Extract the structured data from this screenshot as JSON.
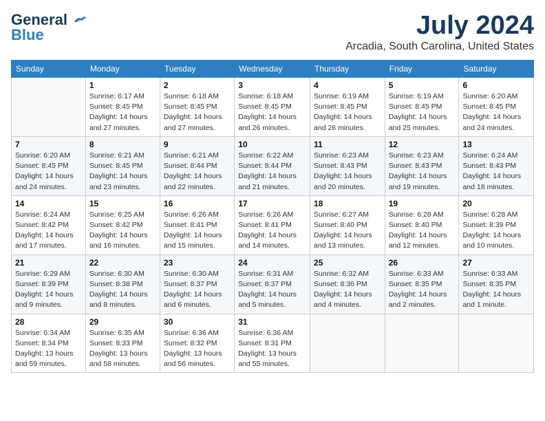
{
  "logo": {
    "line1": "General",
    "line2": "Blue"
  },
  "header": {
    "month": "July 2024",
    "location": "Arcadia, South Carolina, United States"
  },
  "weekdays": [
    "Sunday",
    "Monday",
    "Tuesday",
    "Wednesday",
    "Thursday",
    "Friday",
    "Saturday"
  ],
  "weeks": [
    [
      {
        "day": "",
        "sunrise": "",
        "sunset": "",
        "daylight": ""
      },
      {
        "day": "1",
        "sunrise": "Sunrise: 6:17 AM",
        "sunset": "Sunset: 8:45 PM",
        "daylight": "Daylight: 14 hours and 27 minutes."
      },
      {
        "day": "2",
        "sunrise": "Sunrise: 6:18 AM",
        "sunset": "Sunset: 8:45 PM",
        "daylight": "Daylight: 14 hours and 27 minutes."
      },
      {
        "day": "3",
        "sunrise": "Sunrise: 6:18 AM",
        "sunset": "Sunset: 8:45 PM",
        "daylight": "Daylight: 14 hours and 26 minutes."
      },
      {
        "day": "4",
        "sunrise": "Sunrise: 6:19 AM",
        "sunset": "Sunset: 8:45 PM",
        "daylight": "Daylight: 14 hours and 26 minutes."
      },
      {
        "day": "5",
        "sunrise": "Sunrise: 6:19 AM",
        "sunset": "Sunset: 8:45 PM",
        "daylight": "Daylight: 14 hours and 25 minutes."
      },
      {
        "day": "6",
        "sunrise": "Sunrise: 6:20 AM",
        "sunset": "Sunset: 8:45 PM",
        "daylight": "Daylight: 14 hours and 24 minutes."
      }
    ],
    [
      {
        "day": "7",
        "sunrise": "Sunrise: 6:20 AM",
        "sunset": "Sunset: 8:45 PM",
        "daylight": "Daylight: 14 hours and 24 minutes."
      },
      {
        "day": "8",
        "sunrise": "Sunrise: 6:21 AM",
        "sunset": "Sunset: 8:45 PM",
        "daylight": "Daylight: 14 hours and 23 minutes."
      },
      {
        "day": "9",
        "sunrise": "Sunrise: 6:21 AM",
        "sunset": "Sunset: 8:44 PM",
        "daylight": "Daylight: 14 hours and 22 minutes."
      },
      {
        "day": "10",
        "sunrise": "Sunrise: 6:22 AM",
        "sunset": "Sunset: 8:44 PM",
        "daylight": "Daylight: 14 hours and 21 minutes."
      },
      {
        "day": "11",
        "sunrise": "Sunrise: 6:23 AM",
        "sunset": "Sunset: 8:43 PM",
        "daylight": "Daylight: 14 hours and 20 minutes."
      },
      {
        "day": "12",
        "sunrise": "Sunrise: 6:23 AM",
        "sunset": "Sunset: 8:43 PM",
        "daylight": "Daylight: 14 hours and 19 minutes."
      },
      {
        "day": "13",
        "sunrise": "Sunrise: 6:24 AM",
        "sunset": "Sunset: 8:43 PM",
        "daylight": "Daylight: 14 hours and 18 minutes."
      }
    ],
    [
      {
        "day": "14",
        "sunrise": "Sunrise: 6:24 AM",
        "sunset": "Sunset: 8:42 PM",
        "daylight": "Daylight: 14 hours and 17 minutes."
      },
      {
        "day": "15",
        "sunrise": "Sunrise: 6:25 AM",
        "sunset": "Sunset: 8:42 PM",
        "daylight": "Daylight: 14 hours and 16 minutes."
      },
      {
        "day": "16",
        "sunrise": "Sunrise: 6:26 AM",
        "sunset": "Sunset: 8:41 PM",
        "daylight": "Daylight: 14 hours and 15 minutes."
      },
      {
        "day": "17",
        "sunrise": "Sunrise: 6:26 AM",
        "sunset": "Sunset: 8:41 PM",
        "daylight": "Daylight: 14 hours and 14 minutes."
      },
      {
        "day": "18",
        "sunrise": "Sunrise: 6:27 AM",
        "sunset": "Sunset: 8:40 PM",
        "daylight": "Daylight: 14 hours and 13 minutes."
      },
      {
        "day": "19",
        "sunrise": "Sunrise: 6:28 AM",
        "sunset": "Sunset: 8:40 PM",
        "daylight": "Daylight: 14 hours and 12 minutes."
      },
      {
        "day": "20",
        "sunrise": "Sunrise: 6:28 AM",
        "sunset": "Sunset: 8:39 PM",
        "daylight": "Daylight: 14 hours and 10 minutes."
      }
    ],
    [
      {
        "day": "21",
        "sunrise": "Sunrise: 6:29 AM",
        "sunset": "Sunset: 8:39 PM",
        "daylight": "Daylight: 14 hours and 9 minutes."
      },
      {
        "day": "22",
        "sunrise": "Sunrise: 6:30 AM",
        "sunset": "Sunset: 8:38 PM",
        "daylight": "Daylight: 14 hours and 8 minutes."
      },
      {
        "day": "23",
        "sunrise": "Sunrise: 6:30 AM",
        "sunset": "Sunset: 8:37 PM",
        "daylight": "Daylight: 14 hours and 6 minutes."
      },
      {
        "day": "24",
        "sunrise": "Sunrise: 6:31 AM",
        "sunset": "Sunset: 8:37 PM",
        "daylight": "Daylight: 14 hours and 5 minutes."
      },
      {
        "day": "25",
        "sunrise": "Sunrise: 6:32 AM",
        "sunset": "Sunset: 8:36 PM",
        "daylight": "Daylight: 14 hours and 4 minutes."
      },
      {
        "day": "26",
        "sunrise": "Sunrise: 6:33 AM",
        "sunset": "Sunset: 8:35 PM",
        "daylight": "Daylight: 14 hours and 2 minutes."
      },
      {
        "day": "27",
        "sunrise": "Sunrise: 6:33 AM",
        "sunset": "Sunset: 8:35 PM",
        "daylight": "Daylight: 14 hours and 1 minute."
      }
    ],
    [
      {
        "day": "28",
        "sunrise": "Sunrise: 6:34 AM",
        "sunset": "Sunset: 8:34 PM",
        "daylight": "Daylight: 13 hours and 59 minutes."
      },
      {
        "day": "29",
        "sunrise": "Sunrise: 6:35 AM",
        "sunset": "Sunset: 8:33 PM",
        "daylight": "Daylight: 13 hours and 58 minutes."
      },
      {
        "day": "30",
        "sunrise": "Sunrise: 6:36 AM",
        "sunset": "Sunset: 8:32 PM",
        "daylight": "Daylight: 13 hours and 56 minutes."
      },
      {
        "day": "31",
        "sunrise": "Sunrise: 6:36 AM",
        "sunset": "Sunset: 8:31 PM",
        "daylight": "Daylight: 13 hours and 55 minutes."
      },
      {
        "day": "",
        "sunrise": "",
        "sunset": "",
        "daylight": ""
      },
      {
        "day": "",
        "sunrise": "",
        "sunset": "",
        "daylight": ""
      },
      {
        "day": "",
        "sunrise": "",
        "sunset": "",
        "daylight": ""
      }
    ]
  ]
}
